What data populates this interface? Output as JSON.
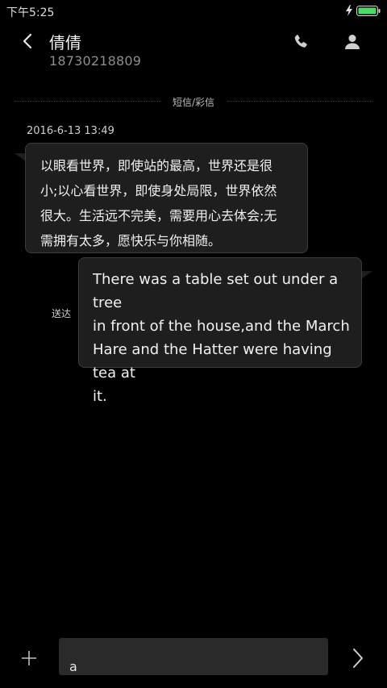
{
  "status_bar": {
    "time": "下午5:25",
    "battery_color": "#4cd964"
  },
  "header": {
    "contact_name": "倩倩",
    "phone_number": "18730218809",
    "icons": [
      "back-icon",
      "phone-icon",
      "contact-icon"
    ]
  },
  "conversation": {
    "divider_label": "短信/彩信",
    "timestamp": "2016-6-13 13:49",
    "incoming": {
      "lines": [
        "以眼看世界，即使站的最高，世界还是很",
        "小;以心看世界，即使身处局限，世界依然",
        "很大。生活远不完美，需要用心去体会;无",
        "需拥有太多，愿快乐与你相随。"
      ]
    },
    "outgoing": {
      "lines": [
        "There was a table set out under a tree",
        "in front of the house,and the March",
        "Hare and the Hatter were having tea at",
        "it."
      ],
      "status": "送达"
    }
  },
  "composer": {
    "text": "a",
    "icons": [
      "plus-icon",
      "send-icon"
    ]
  }
}
